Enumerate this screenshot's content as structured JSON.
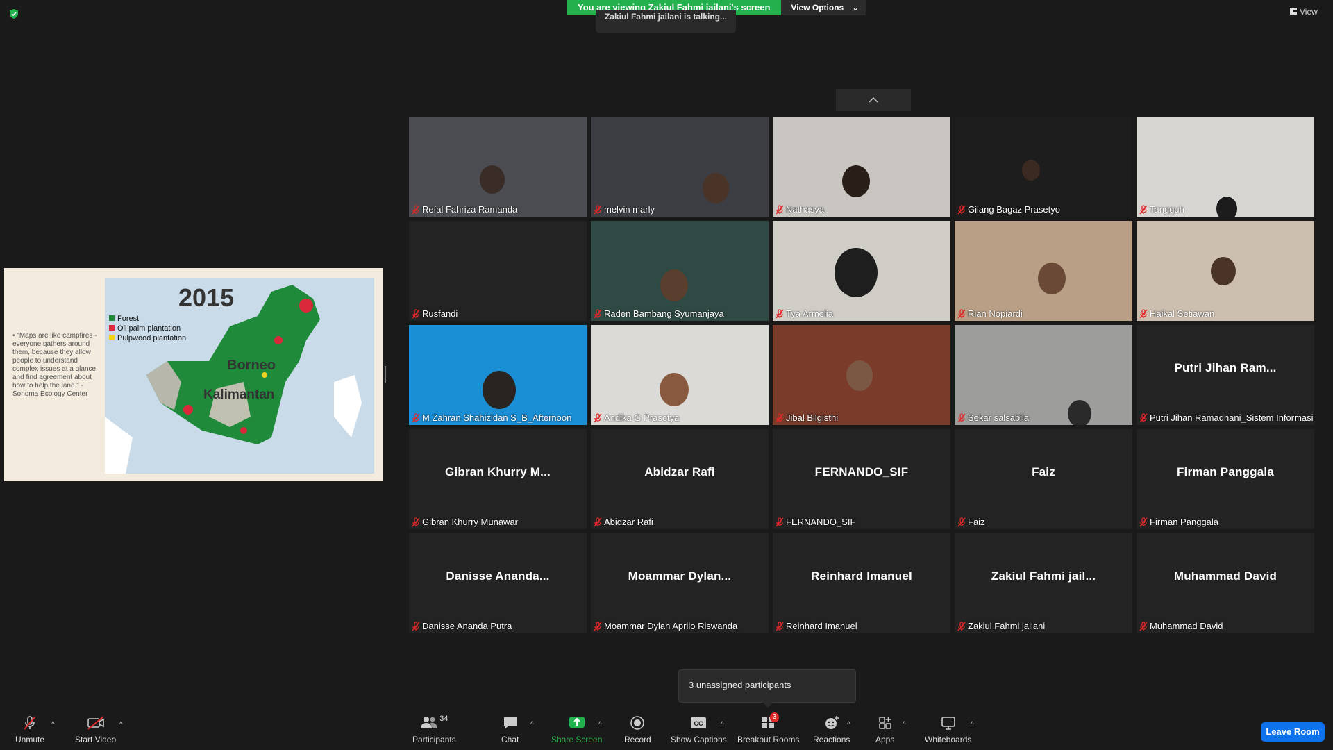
{
  "banner": {
    "viewing_text": "You are viewing Zakiul Fahmi jailani's screen",
    "view_options_label": "View Options",
    "talking_text": "Zakiul Fahmi jailani is talking..."
  },
  "top_right": {
    "view_label": "View"
  },
  "shared_screen": {
    "quote": "\"Maps are like campfires - everyone gathers around them, because they allow people to understand complex issues at a glance, and find agreement about how to help the land.\" - Sonoma Ecology Center",
    "map_year": "2015",
    "legend": [
      {
        "label": "Forest",
        "color": "#1e8a3a"
      },
      {
        "label": "Oil palm plantation",
        "color": "#d8283a"
      },
      {
        "label": "Pulpwood plantation",
        "color": "#f2d21b"
      }
    ],
    "map_label_borneo": "Borneo",
    "map_label_kalimantan": "Kalimantan"
  },
  "tiles": [
    {
      "name": "Refal Fahriza Ramanda",
      "big": ""
    },
    {
      "name": "melvin marly",
      "big": ""
    },
    {
      "name": "Nathasya",
      "big": ""
    },
    {
      "name": "Gilang Bagaz Prasetyo",
      "big": ""
    },
    {
      "name": "Tangguh",
      "big": ""
    },
    {
      "name": "Rusfandi",
      "big": ""
    },
    {
      "name": "Raden Bambang Syumanjaya",
      "big": ""
    },
    {
      "name": "Tya Armelia",
      "big": ""
    },
    {
      "name": "Rian Nopiardi",
      "big": ""
    },
    {
      "name": "Haikal Setiawan",
      "big": ""
    },
    {
      "name": "M Zahran Shahizidan S_B_Afternoon",
      "big": ""
    },
    {
      "name": "Andika G Prasetya",
      "big": ""
    },
    {
      "name": "Jibal Bilgisthi",
      "big": ""
    },
    {
      "name": "Sekar salsabila",
      "big": ""
    },
    {
      "name": "Putri Jihan Ramadhani_Sistem Informasi",
      "big": "Putri Jihan Ram..."
    },
    {
      "name": "Gibran Khurry Munawar",
      "big": "Gibran Khurry M..."
    },
    {
      "name": "Abidzar Rafi",
      "big": "Abidzar Rafi"
    },
    {
      "name": "FERNANDO_SIF",
      "big": "FERNANDO_SIF"
    },
    {
      "name": "Faiz",
      "big": "Faiz"
    },
    {
      "name": "Firman Panggala",
      "big": "Firman Panggala"
    },
    {
      "name": "Danisse Ananda Putra",
      "big": "Danisse Ananda..."
    },
    {
      "name": "Moammar Dylan Aprilo Riswanda",
      "big": "Moammar Dylan..."
    },
    {
      "name": "Reinhard Imanuel",
      "big": "Reinhard Imanuel"
    },
    {
      "name": "Zakiul Fahmi jailani",
      "big": "Zakiul Fahmi jail..."
    },
    {
      "name": "Muhammad David",
      "big": "Muhammad David"
    }
  ],
  "popup": {
    "unassigned": "3 unassigned participants"
  },
  "toolbar": {
    "unmute": "Unmute",
    "start_video": "Start Video",
    "participants": "Participants",
    "participants_count": "34",
    "chat": "Chat",
    "share_screen": "Share Screen",
    "record": "Record",
    "show_captions": "Show Captions",
    "breakout_rooms": "Breakout Rooms",
    "breakout_badge": "3",
    "reactions": "Reactions",
    "apps": "Apps",
    "whiteboards": "Whiteboards",
    "leave_room": "Leave Room"
  },
  "colors": {
    "share_green": "#22b14c",
    "leave_blue": "#0e72ed",
    "muted_red": "#e02828"
  }
}
